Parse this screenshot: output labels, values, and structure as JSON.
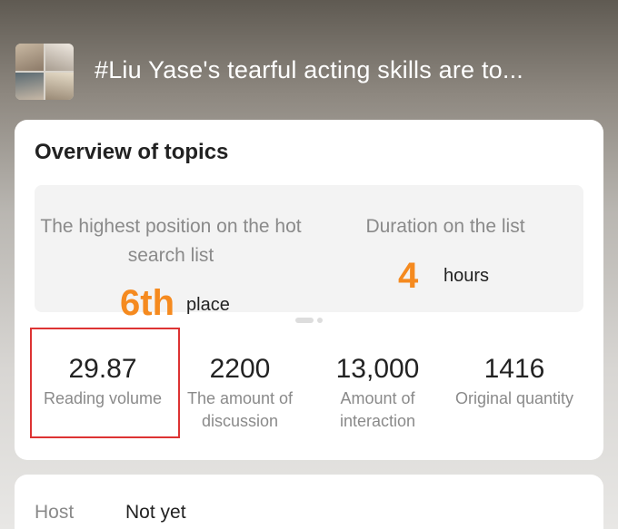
{
  "header": {
    "title": "#Liu Yase's tearful acting skills are to..."
  },
  "overview": {
    "title": "Overview of topics",
    "highest_position": {
      "label": "The highest position on the hot search list",
      "value": "6th",
      "unit": "place"
    },
    "duration": {
      "label": "Duration on the list",
      "value": "4",
      "unit": "hours"
    },
    "metrics": [
      {
        "value": "29.87",
        "label": "Reading volume"
      },
      {
        "value": "2200",
        "label": "The amount of discussion"
      },
      {
        "value": "13,000",
        "label": "Amount of interaction"
      },
      {
        "value": "1416",
        "label": "Original quantity"
      }
    ]
  },
  "details": {
    "host_label": "Host",
    "host_value": "Not yet"
  },
  "colors": {
    "accent": "#f58a1f",
    "highlight_border": "#dd3333"
  }
}
